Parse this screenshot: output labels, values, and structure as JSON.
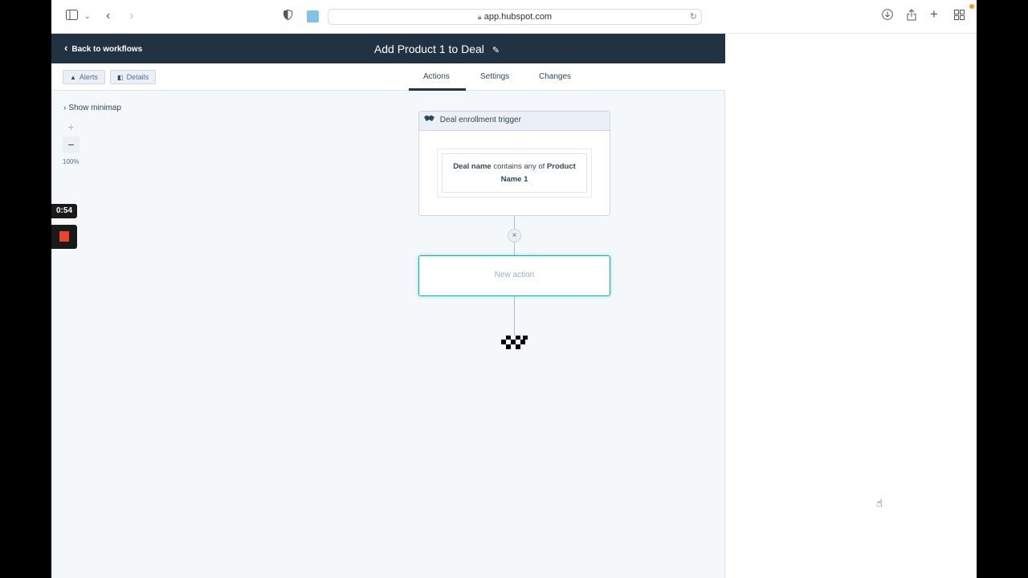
{
  "browser": {
    "url": "app.hubspot.com",
    "icons": [
      "sidebar-icon",
      "chevron-down-icon",
      "back-icon",
      "forward-icon",
      "shield-icon",
      "tab-favicon",
      "lock-icon",
      "reload-icon",
      "download-icon",
      "share-icon",
      "new-tab-icon",
      "tab-overview-icon"
    ]
  },
  "header": {
    "back_label": "Back to workflows",
    "title": "Add Product 1 to Deal"
  },
  "subbar": {
    "alerts_label": "Alerts",
    "details_label": "Details",
    "tabs": [
      {
        "label": "Actions",
        "active": true
      },
      {
        "label": "Settings",
        "active": false
      },
      {
        "label": "Changes",
        "active": false
      }
    ]
  },
  "canvas": {
    "minimap_label": "Show minimap",
    "zoom_in": "+",
    "zoom_out": "−",
    "zoom_level": "100%",
    "trigger": {
      "title": "Deal enrollment trigger",
      "filter_prop": "Deal name",
      "filter_op": "contains any of",
      "filter_value_1": "Product",
      "filter_value_2": "Name 1"
    },
    "new_action_label": "New action"
  },
  "recording": {
    "timer": "0:54"
  },
  "colors": {
    "header_bg": "#213343",
    "canvas_bg": "#f5f8fa",
    "accent_teal": "#00bda5",
    "record_red": "#e8452c"
  }
}
